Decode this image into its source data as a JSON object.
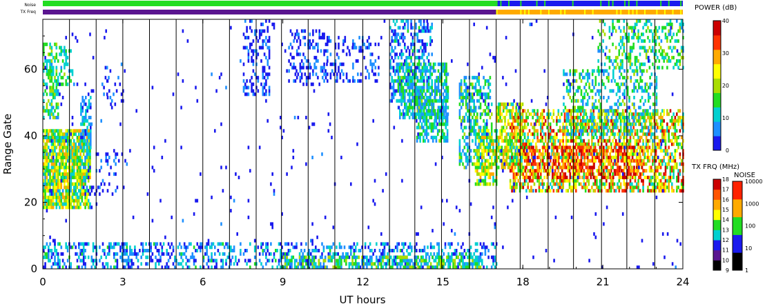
{
  "chart_data": {
    "type": "heatmap",
    "xlabel": "UT hours",
    "ylabel": "Range Gate",
    "xlim": [
      0,
      24
    ],
    "ylim": [
      0,
      75
    ],
    "x_ticks": [
      0,
      3,
      6,
      9,
      12,
      15,
      18,
      21,
      24
    ],
    "y_ticks": [
      0,
      20,
      40,
      60
    ],
    "scan_boundaries_ut": [
      1.0,
      2.0,
      3.0,
      4.0,
      5.0,
      6.0,
      7.0,
      8.0,
      8.95,
      9.95,
      10.95,
      12.0,
      13.0,
      13.95,
      14.95,
      16.0,
      17.0,
      17.9,
      18.95,
      19.9,
      20.95,
      21.9,
      22.95
    ],
    "strip_labels": {
      "noise": "Noise",
      "tx_freq": "TX Freq"
    },
    "noise_strip": [
      {
        "from_ut": 0.0,
        "to_ut": 17.0,
        "color": "#22dd22"
      },
      {
        "from_ut": 17.0,
        "to_ut": 24.0,
        "color": "#1a1aee"
      }
    ],
    "tx_freq_strip": [
      {
        "from_ut": 0.0,
        "to_ut": 17.0,
        "color": "#5a1590"
      },
      {
        "from_ut": 17.0,
        "to_ut": 24.0,
        "color": "#ffaa00"
      }
    ],
    "power_scale": {
      "title": "POWER (dB)",
      "min": 0,
      "max": 40,
      "ticks": [
        0,
        10,
        20,
        30,
        40
      ],
      "colors": [
        "#1a1aee",
        "#1e90ff",
        "#00d0d0",
        "#22dd22",
        "#aadd00",
        "#ffff00",
        "#ffaa00",
        "#ff3300",
        "#cc0000"
      ]
    },
    "tx_freq_scale": {
      "title": "TX FRQ (MHz)",
      "ticks": [
        9,
        10,
        11,
        12,
        13,
        14,
        15,
        16,
        17,
        18
      ],
      "colors": [
        "#000000",
        "#5a1590",
        "#1a1aee",
        "#00d0d0",
        "#22dd22",
        "#ffff00",
        "#ffaa00",
        "#ff5500",
        "#cc0000"
      ]
    },
    "noise_scale": {
      "title": "NOISE",
      "ticks": [
        "1",
        "10",
        "100",
        "1000",
        "10000"
      ],
      "colors": [
        "#000000",
        "#1a1aee",
        "#22dd22",
        "#ffaa00",
        "#ff2200"
      ]
    },
    "echo_regions": [
      {
        "x": [
          0.0,
          1.8
        ],
        "y": [
          18,
          42
        ],
        "power": [
          8,
          30
        ],
        "density": 0.85
      },
      {
        "x": [
          0.0,
          0.6
        ],
        "y": [
          45,
          68
        ],
        "power": [
          8,
          20
        ],
        "density": 0.5
      },
      {
        "x": [
          0.6,
          1.1
        ],
        "y": [
          55,
          68
        ],
        "power": [
          8,
          18
        ],
        "density": 0.35
      },
      {
        "x": [
          1.4,
          1.8
        ],
        "y": [
          36,
          52
        ],
        "power": [
          2,
          14
        ],
        "density": 0.5
      },
      {
        "x": [
          1.5,
          3.2
        ],
        "y": [
          22,
          35
        ],
        "power": [
          0,
          6
        ],
        "density": 0.12
      },
      {
        "x": [
          2.2,
          3.1
        ],
        "y": [
          48,
          62
        ],
        "power": [
          0,
          6
        ],
        "density": 0.12
      },
      {
        "x": [
          7.5,
          8.5
        ],
        "y": [
          52,
          75
        ],
        "power": [
          0,
          7
        ],
        "density": 0.28
      },
      {
        "x": [
          9.2,
          10.7
        ],
        "y": [
          55,
          72
        ],
        "power": [
          0,
          7
        ],
        "density": 0.3
      },
      {
        "x": [
          10.7,
          12.6
        ],
        "y": [
          56,
          70
        ],
        "power": [
          0,
          7
        ],
        "density": 0.2
      },
      {
        "x": [
          13.0,
          14.6
        ],
        "y": [
          50,
          75
        ],
        "power": [
          0,
          14
        ],
        "density": 0.45
      },
      {
        "x": [
          13.3,
          15.2
        ],
        "y": [
          45,
          62
        ],
        "power": [
          5,
          18
        ],
        "density": 0.6
      },
      {
        "x": [
          14.0,
          15.2
        ],
        "y": [
          38,
          52
        ],
        "power": [
          5,
          18
        ],
        "density": 0.55
      },
      {
        "x": [
          15.6,
          16.8
        ],
        "y": [
          30,
          58
        ],
        "power": [
          4,
          20
        ],
        "density": 0.5
      },
      {
        "x": [
          16.2,
          17.0
        ],
        "y": [
          25,
          42
        ],
        "power": [
          10,
          30
        ],
        "density": 0.6
      },
      {
        "x": [
          17.0,
          18.0
        ],
        "y": [
          30,
          50
        ],
        "power": [
          12,
          30
        ],
        "density": 0.65
      },
      {
        "x": [
          17.5,
          24.0
        ],
        "y": [
          23,
          48
        ],
        "power": [
          10,
          38
        ],
        "density": 0.55
      },
      {
        "x": [
          18.0,
          22.5
        ],
        "y": [
          27,
          37
        ],
        "power": [
          25,
          40
        ],
        "density": 0.5
      },
      {
        "x": [
          19.5,
          23.0
        ],
        "y": [
          40,
          60
        ],
        "power": [
          5,
          20
        ],
        "density": 0.35
      },
      {
        "x": [
          20.8,
          24.0
        ],
        "y": [
          60,
          75
        ],
        "power": [
          8,
          20
        ],
        "density": 0.3
      },
      {
        "x": [
          0.0,
          17.0
        ],
        "y": [
          0,
          8
        ],
        "power": [
          0,
          14
        ],
        "density": 0.35
      },
      {
        "x": [
          9.0,
          16.5
        ],
        "y": [
          0,
          4
        ],
        "power": [
          5,
          22
        ],
        "density": 0.55
      },
      {
        "x": [
          0.0,
          24.0
        ],
        "y": [
          0,
          75
        ],
        "power": [
          0,
          5
        ],
        "density": 0.012
      }
    ]
  }
}
